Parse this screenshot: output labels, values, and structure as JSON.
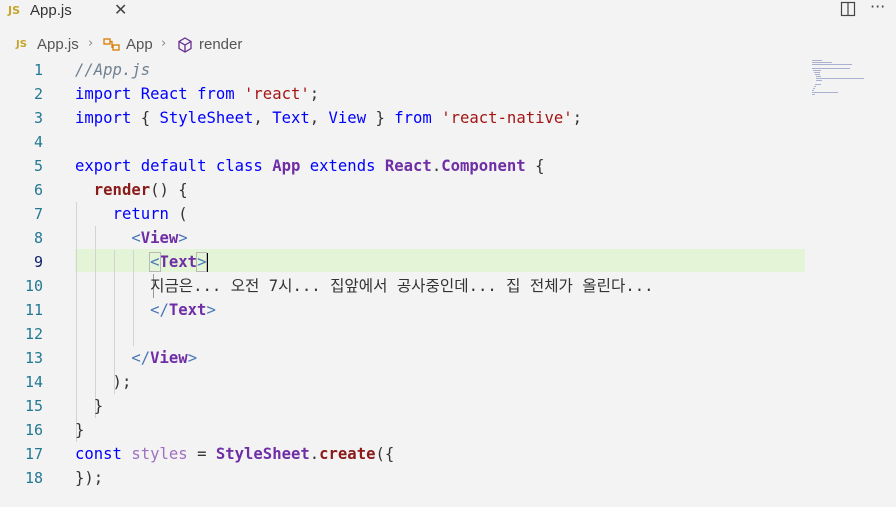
{
  "tab": {
    "icon": "JS",
    "label": "App.js"
  },
  "breadcrumb": {
    "file_icon": "JS",
    "file": "App.js",
    "class_name": "App",
    "method_name": "render"
  },
  "editor": {
    "active_line": 9,
    "lines": [
      "//App.js",
      "import React from 'react';",
      "import { StyleSheet, Text, View } from 'react-native';",
      "",
      "export default class App extends React.Component {",
      "  render() {",
      "    return (",
      "      <View>",
      "        <Text>",
      "        지금은... 오전 7시... 집앞에서 공사중인데... 집 전체가 올린다...",
      "        </Text>",
      "",
      "      </View>",
      "    );",
      "  }",
      "}",
      "const styles = StyleSheet.create({",
      "});"
    ]
  }
}
